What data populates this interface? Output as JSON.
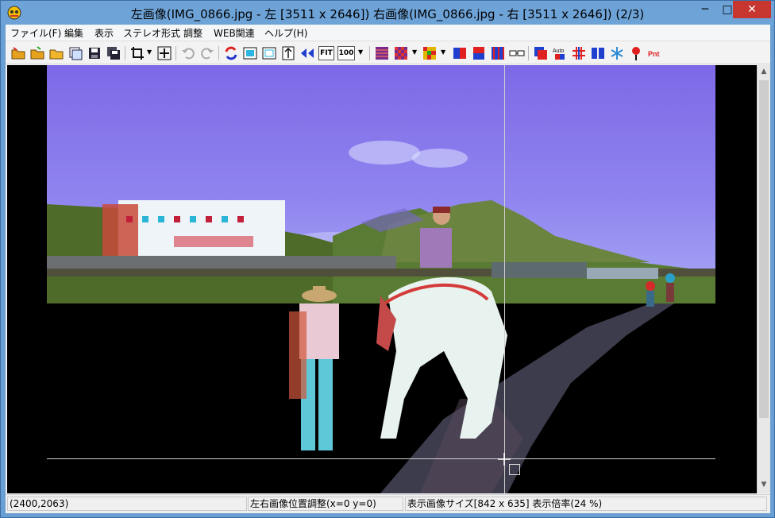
{
  "window": {
    "title": "左画像(IMG_0866.jpg - 左 [3511 x 2646]) 右画像(IMG_0866.jpg - 右 [3511 x 2646])  (2/3)",
    "minimize": "─",
    "maximize": "□",
    "close": "✕"
  },
  "menu": {
    "items": [
      "ファイル(F)",
      "編集",
      "表示",
      "ステレオ形式",
      "調整",
      "WEB関連",
      "ヘルプ(H)"
    ]
  },
  "toolbar": {
    "fit_label": "FIT",
    "zoom100_label": "100",
    "auto_label": "Auto",
    "pnt_label": "Pnt",
    "icons": [
      "open-folder-icon",
      "open-stereo-icon",
      "open-pair-icon",
      "open-multi-icon",
      "save-icon",
      "save-all-icon",
      "crop-icon",
      "move-icon",
      "undo-icon",
      "redo-icon",
      "swap-lr-icon",
      "window-fit-icon",
      "window-frame-icon",
      "align-vertical-icon",
      "fit-arrows-icon",
      "fit-icon",
      "zoom-100-icon",
      "anaglyph-line-icon",
      "anaglyph-check-icon",
      "anaglyph-mosaic-icon",
      "side-by-side-icon",
      "top-bottom-icon",
      "interlace-icon",
      "glasses-icon",
      "anaglyph-red-icon",
      "auto-adjust-icon",
      "grid-adjust-icon",
      "parallel-icon",
      "snowflake-icon",
      "pin-icon",
      "point-icon"
    ],
    "colors": {
      "red": "#e02020",
      "blue": "#1f3fcf",
      "purple": "#7a2a8a",
      "green": "#2a8a2a"
    }
  },
  "viewport": {
    "image_alt": "Red-cyan anaglyph photo of a child riding a white horse led by a man in a straw hat on a paved path through grassland with mountains"
  },
  "status": {
    "coords": "(2400,2063)",
    "adjust": "左右画像位置調整(x=0 y=0)",
    "display": "表示画像サイズ[842 x 635]  表示倍率(24 %)"
  }
}
